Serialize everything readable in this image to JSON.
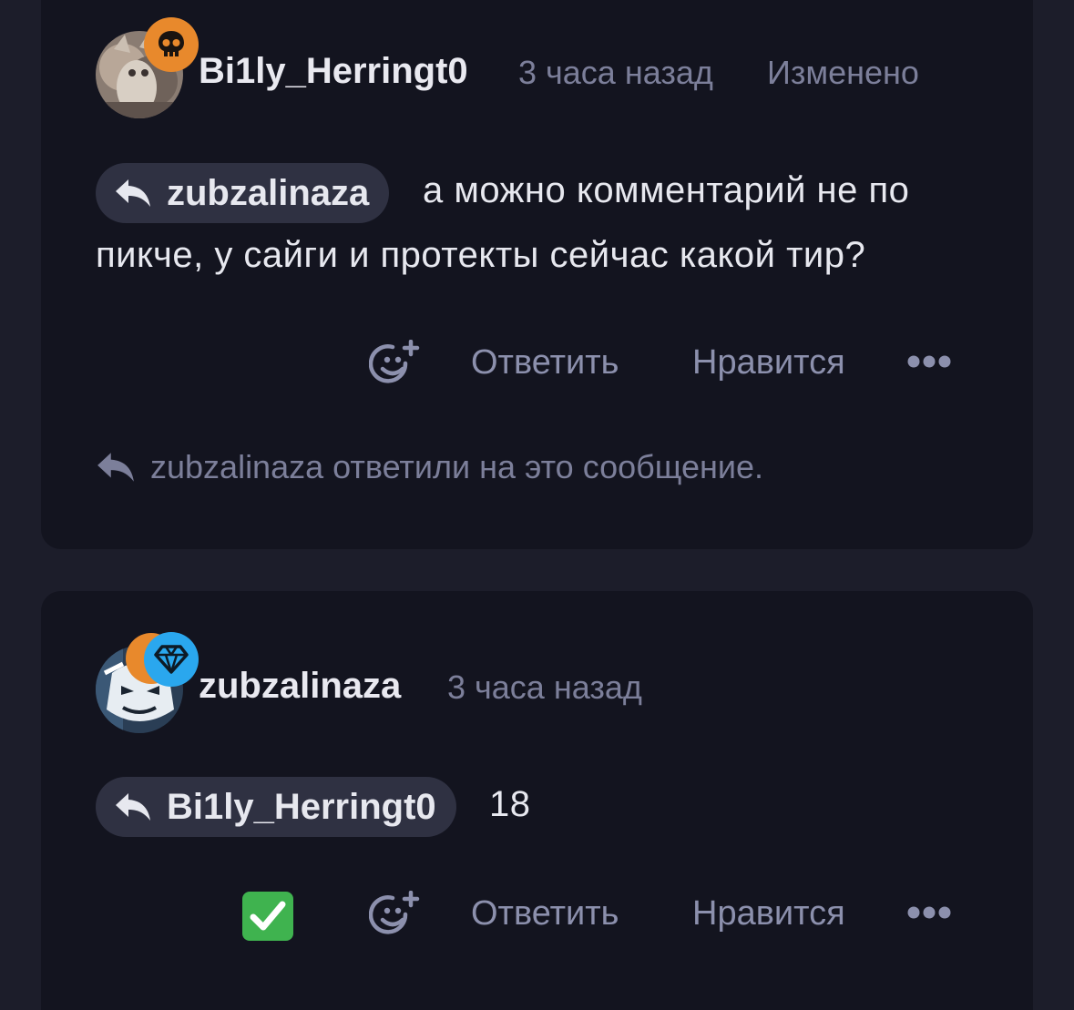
{
  "comments": [
    {
      "username": "Bi1ly_Herringt0",
      "time": "3 часа назад",
      "edited": "Изменено",
      "reply_to": "zubzalinaza",
      "text_line1": "а можно комментарий не по",
      "text_line2": "пикче, у сайги и протекты сейчас какой тир?",
      "actions": {
        "reply": "Ответить",
        "like": "Нравится"
      },
      "replied_note": "zubzalinaza ответили на это сообщение.",
      "badge_color": "#e8892c"
    },
    {
      "username": "zubzalinaza",
      "time": "3 часа назад",
      "reply_to": "Bi1ly_Herringt0",
      "text": "18",
      "actions": {
        "reply": "Ответить",
        "like": "Нравится"
      },
      "badge_color": "#2aa7ee",
      "badge_back_color": "#e8892c"
    }
  ],
  "icons": {
    "badge1": "skull-icon",
    "badge2": "diamond-icon",
    "reaction": "add-reaction-icon",
    "more": "more-dots-icon",
    "reply": "reply-arrow-icon",
    "status": "check-mark-icon"
  }
}
